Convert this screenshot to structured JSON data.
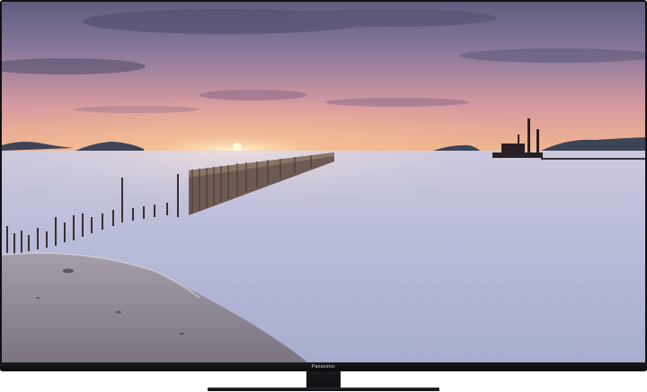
{
  "tv": {
    "brand": "Panasonic"
  },
  "colors": {
    "frame": "#111214",
    "sky_top": "#6b6a8c",
    "sky_glow": "#f0b08a",
    "sun": "#fff1c8",
    "water": "#b8bdd8",
    "sand": "#8f8794"
  }
}
